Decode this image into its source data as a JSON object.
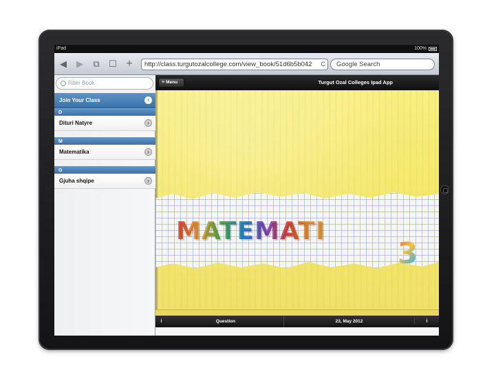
{
  "status_bar": {
    "carrier": "iPad",
    "battery": "100%"
  },
  "browser": {
    "url": "http://class.turgutozalcollege.com/view_book/51d6b5b042",
    "search_placeholder": "Google Search",
    "nav_icons": [
      "back-icon",
      "forward-icon",
      "pages-icon",
      "bookmarks-icon",
      "add-icon"
    ]
  },
  "sidebar": {
    "filter_placeholder": "Filter Book",
    "join_label": "Join Your Class",
    "sections": [
      {
        "letter": "D",
        "item": "Dituri Natyre"
      },
      {
        "letter": "M",
        "item": "Matematika"
      },
      {
        "letter": "G",
        "item": "Gjuha shqipe"
      }
    ]
  },
  "main": {
    "menu_label": "Menu",
    "title": "Turgut Ozal Colleges Ipad App",
    "cover_title": "MATEMATI",
    "cover_number": "3"
  },
  "footer": {
    "question_label": "Question",
    "date": "23, May 2012",
    "info_glyph": "i"
  },
  "colors": {
    "accent_blue": "#3a72ab",
    "cover_yellow": "#f4e76a",
    "toolbar_dark": "#141414"
  }
}
